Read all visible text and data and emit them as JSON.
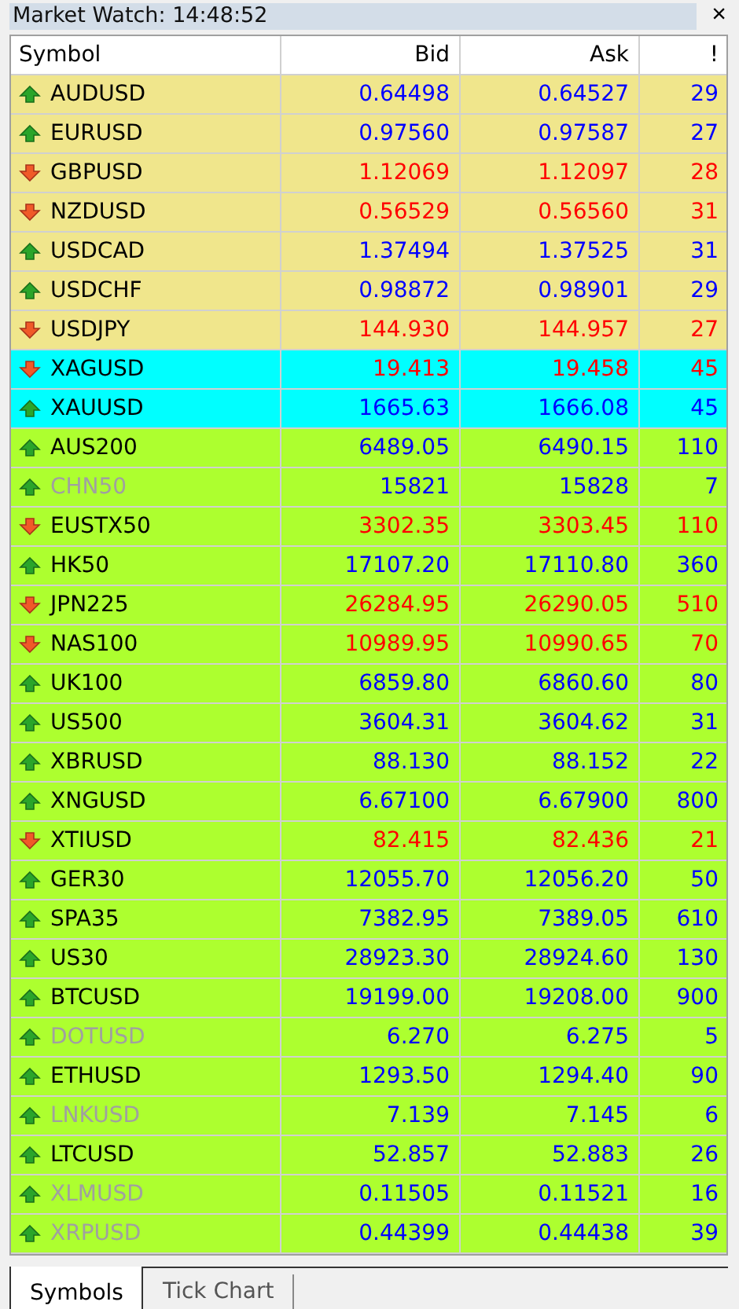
{
  "window": {
    "title": "Market Watch: 14:48:52",
    "close": "×"
  },
  "table": {
    "columns": [
      "Symbol",
      "Bid",
      "Ask",
      "!"
    ],
    "rows": [
      {
        "symbol": "AUDUSD",
        "bid": "0.64498",
        "ask": "0.64527",
        "spread": "29",
        "kind": "up",
        "disabled": false,
        "color": "#f0e68c"
      },
      {
        "symbol": "EURUSD",
        "bid": "0.97560",
        "ask": "0.97587",
        "spread": "27",
        "kind": "up",
        "disabled": false,
        "color": "#f0e68c"
      },
      {
        "symbol": "GBPUSD",
        "bid": "1.12069",
        "ask": "1.12097",
        "spread": "28",
        "kind": "down",
        "disabled": false,
        "color": "#f0e68c"
      },
      {
        "symbol": "NZDUSD",
        "bid": "0.56529",
        "ask": "0.56560",
        "spread": "31",
        "kind": "down",
        "disabled": false,
        "color": "#f0e68c"
      },
      {
        "symbol": "USDCAD",
        "bid": "1.37494",
        "ask": "1.37525",
        "spread": "31",
        "kind": "up",
        "disabled": false,
        "color": "#f0e68c"
      },
      {
        "symbol": "USDCHF",
        "bid": "0.98872",
        "ask": "0.98901",
        "spread": "29",
        "kind": "up",
        "disabled": false,
        "color": "#f0e68c"
      },
      {
        "symbol": "USDJPY",
        "bid": "144.930",
        "ask": "144.957",
        "spread": "27",
        "kind": "down",
        "disabled": false,
        "color": "#f0e68c"
      },
      {
        "symbol": "XAGUSD",
        "bid": "19.413",
        "ask": "19.458",
        "spread": "45",
        "kind": "down",
        "disabled": false,
        "color": "#00ffff"
      },
      {
        "symbol": "XAUUSD",
        "bid": "1665.63",
        "ask": "1666.08",
        "spread": "45",
        "kind": "up",
        "disabled": false,
        "color": "#00ffff"
      },
      {
        "symbol": "AUS200",
        "bid": "6489.05",
        "ask": "6490.15",
        "spread": "110",
        "kind": "up",
        "disabled": false,
        "color": "#adff2f"
      },
      {
        "symbol": "CHN50",
        "bid": "15821",
        "ask": "15828",
        "spread": "7",
        "kind": "up",
        "disabled": true,
        "color": "#adff2f"
      },
      {
        "symbol": "EUSTX50",
        "bid": "3302.35",
        "ask": "3303.45",
        "spread": "110",
        "kind": "down",
        "disabled": false,
        "color": "#adff2f"
      },
      {
        "symbol": "HK50",
        "bid": "17107.20",
        "ask": "17110.80",
        "spread": "360",
        "kind": "up",
        "disabled": false,
        "color": "#adff2f"
      },
      {
        "symbol": "JPN225",
        "bid": "26284.95",
        "ask": "26290.05",
        "spread": "510",
        "kind": "down",
        "disabled": false,
        "color": "#adff2f"
      },
      {
        "symbol": "NAS100",
        "bid": "10989.95",
        "ask": "10990.65",
        "spread": "70",
        "kind": "down",
        "disabled": false,
        "color": "#adff2f"
      },
      {
        "symbol": "UK100",
        "bid": "6859.80",
        "ask": "6860.60",
        "spread": "80",
        "kind": "up",
        "disabled": false,
        "color": "#adff2f"
      },
      {
        "symbol": "US500",
        "bid": "3604.31",
        "ask": "3604.62",
        "spread": "31",
        "kind": "up",
        "disabled": false,
        "color": "#adff2f"
      },
      {
        "symbol": "XBRUSD",
        "bid": "88.130",
        "ask": "88.152",
        "spread": "22",
        "kind": "up",
        "disabled": false,
        "color": "#adff2f"
      },
      {
        "symbol": "XNGUSD",
        "bid": "6.67100",
        "ask": "6.67900",
        "spread": "800",
        "kind": "up",
        "disabled": false,
        "color": "#adff2f"
      },
      {
        "symbol": "XTIUSD",
        "bid": "82.415",
        "ask": "82.436",
        "spread": "21",
        "kind": "down",
        "disabled": false,
        "color": "#adff2f"
      },
      {
        "symbol": "GER30",
        "bid": "12055.70",
        "ask": "12056.20",
        "spread": "50",
        "kind": "up",
        "disabled": false,
        "color": "#adff2f"
      },
      {
        "symbol": "SPA35",
        "bid": "7382.95",
        "ask": "7389.05",
        "spread": "610",
        "kind": "up",
        "disabled": false,
        "color": "#adff2f"
      },
      {
        "symbol": "US30",
        "bid": "28923.30",
        "ask": "28924.60",
        "spread": "130",
        "kind": "up",
        "disabled": false,
        "color": "#adff2f"
      },
      {
        "symbol": "BTCUSD",
        "bid": "19199.00",
        "ask": "19208.00",
        "spread": "900",
        "kind": "up",
        "disabled": false,
        "color": "#adff2f"
      },
      {
        "symbol": "DOTUSD",
        "bid": "6.270",
        "ask": "6.275",
        "spread": "5",
        "kind": "up",
        "disabled": true,
        "color": "#adff2f"
      },
      {
        "symbol": "ETHUSD",
        "bid": "1293.50",
        "ask": "1294.40",
        "spread": "90",
        "kind": "up",
        "disabled": false,
        "color": "#adff2f"
      },
      {
        "symbol": "LNKUSD",
        "bid": "7.139",
        "ask": "7.145",
        "spread": "6",
        "kind": "up",
        "disabled": true,
        "color": "#adff2f"
      },
      {
        "symbol": "LTCUSD",
        "bid": "52.857",
        "ask": "52.883",
        "spread": "26",
        "kind": "up",
        "disabled": false,
        "color": "#adff2f"
      },
      {
        "symbol": "XLMUSD",
        "bid": "0.11505",
        "ask": "0.11521",
        "spread": "16",
        "kind": "up",
        "disabled": true,
        "color": "#adff2f"
      },
      {
        "symbol": "XRPUSD",
        "bid": "0.44399",
        "ask": "0.44438",
        "spread": "39",
        "kind": "up",
        "disabled": true,
        "color": "#adff2f"
      }
    ]
  },
  "tabs": [
    {
      "label": "Symbols",
      "selected": true
    },
    {
      "label": "Tick Chart",
      "selected": false
    }
  ]
}
